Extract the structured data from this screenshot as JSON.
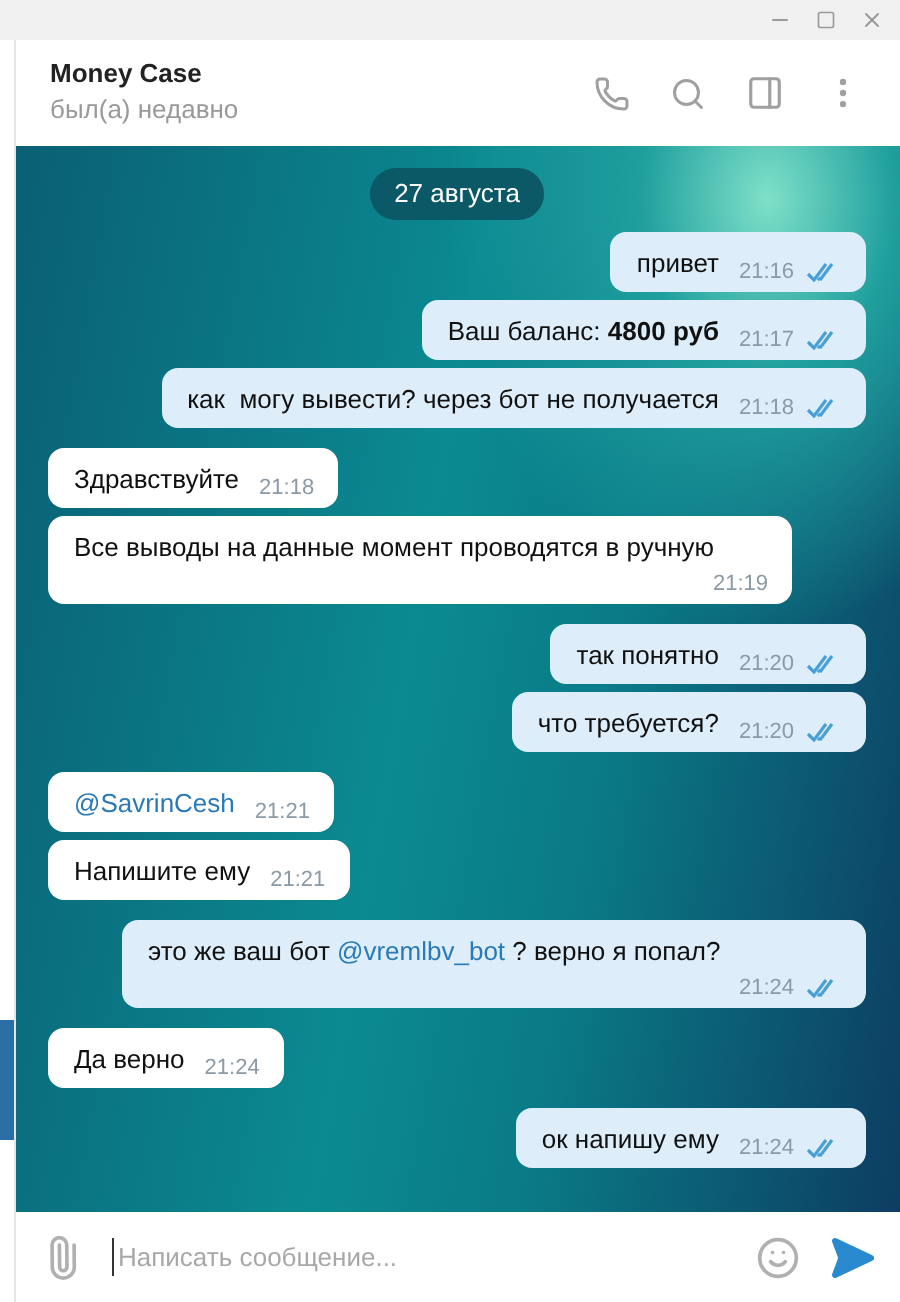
{
  "chat": {
    "title": "Money Case",
    "status": "был(а) недавно"
  },
  "date_badge": "27 августа",
  "messages": [
    {
      "kind": "out",
      "parts": [
        {
          "kind": "text",
          "text": "привет"
        }
      ],
      "time": "21:16",
      "read": true
    },
    {
      "kind": "out",
      "parts": [
        {
          "kind": "text",
          "text": "Ваш баланс: **4800 руб**"
        }
      ],
      "time": "21:17",
      "read": true
    },
    {
      "kind": "out",
      "parts": [
        {
          "kind": "text",
          "text": "как  могу вывести? через бот не получается"
        }
      ],
      "time": "21:18",
      "read": true
    },
    {
      "kind": "in",
      "parts": [
        {
          "kind": "text",
          "text": "Здравствуйте"
        }
      ],
      "time": "21:18"
    },
    {
      "kind": "in",
      "parts": [
        {
          "kind": "text",
          "text": "Все выводы на данные момент проводятся в ручную"
        }
      ],
      "time": "21:19"
    },
    {
      "kind": "out",
      "parts": [
        {
          "kind": "text",
          "text": "так понятно"
        }
      ],
      "time": "21:20",
      "read": true
    },
    {
      "kind": "out",
      "parts": [
        {
          "kind": "text",
          "text": "что требуется?"
        }
      ],
      "time": "21:20",
      "read": true
    },
    {
      "kind": "in",
      "parts": [
        {
          "kind": "mention",
          "text": "@SavrinCesh"
        }
      ],
      "time": "21:21"
    },
    {
      "kind": "in",
      "parts": [
        {
          "kind": "text",
          "text": "Напишите ему"
        }
      ],
      "time": "21:21"
    },
    {
      "kind": "out",
      "parts": [
        {
          "kind": "text",
          "text": "это же ваш бот "
        },
        {
          "kind": "mention",
          "text": "@vremlbv_bot"
        },
        {
          "kind": "text",
          "text": " ? верно я попал?"
        }
      ],
      "time": "21:24",
      "read": true
    },
    {
      "kind": "in",
      "parts": [
        {
          "kind": "text",
          "text": "Да верно"
        }
      ],
      "time": "21:24"
    },
    {
      "kind": "out",
      "parts": [
        {
          "kind": "text",
          "text": "ок напишу ему"
        }
      ],
      "time": "21:24",
      "read": true
    }
  ],
  "composer": {
    "placeholder": "Написать сообщение..."
  }
}
